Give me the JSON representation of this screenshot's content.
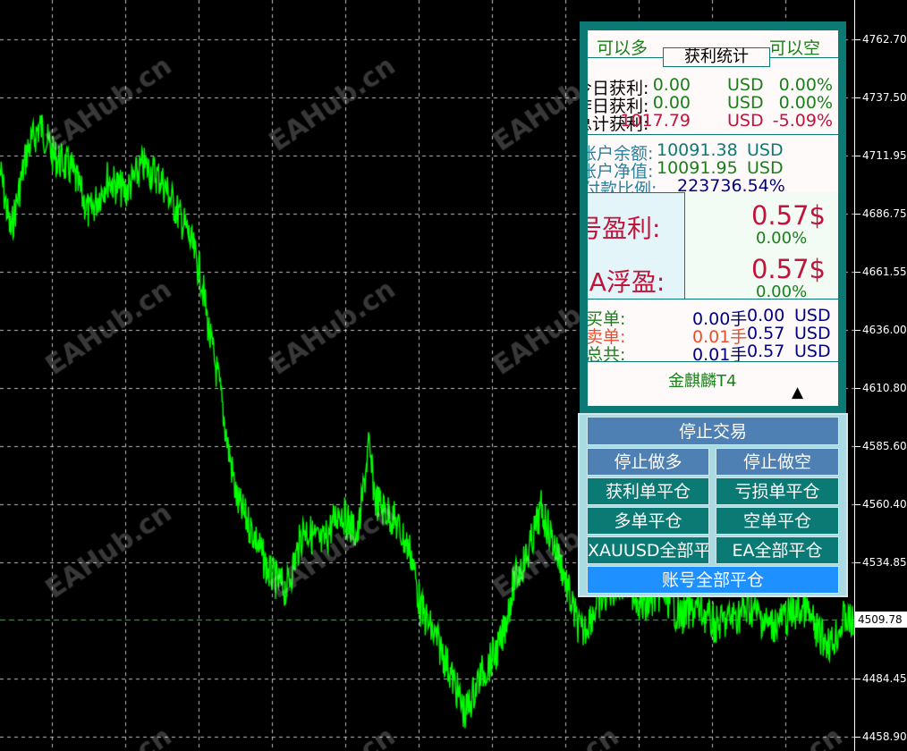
{
  "chart": {
    "series_color": "#00ff00",
    "grid_color": "#ffffff",
    "background": "#000000",
    "current_price": "4509.78",
    "price_axis": [
      "4762.70",
      "4737.50",
      "4711.95",
      "4686.75",
      "4661.55",
      "4636.00",
      "4610.80",
      "4585.60",
      "4560.40",
      "4534.85",
      "4509.78",
      "4484.45",
      "4458.90"
    ],
    "watermark": "EAHub.cn"
  },
  "stats": {
    "can_long": "可以多",
    "can_short": "可以空",
    "title": "获利统计",
    "rows": [
      {
        "label": "今日获利:",
        "value": "0.00",
        "unit": "USD",
        "pct": "0.00%",
        "color": "#1a7f1a"
      },
      {
        "label": "昨日获利:",
        "value": "0.00",
        "unit": "USD",
        "pct": "0.00%",
        "color": "#1a7f1a"
      },
      {
        "label": "总计获利:",
        "value": "1017.79",
        "unit": "USD",
        "pct": "-5.09%",
        "color": "#c0143c"
      }
    ],
    "balance_label": "账户余额:",
    "balance_value": "10091.38",
    "balance_unit": "USD",
    "equity_label": "账户净值:",
    "equity_value": "10091.95",
    "equity_unit": "USD",
    "margin_label": "预付款比例:",
    "margin_value": "223736.54%",
    "account_profit_label": "账号盈利:",
    "account_profit_value": "0.57$",
    "account_profit_pct": "0.00%",
    "ea_float_label": "EA浮盈:",
    "ea_float_value": "0.57$",
    "ea_float_pct": "0.00%",
    "orders": [
      {
        "label": "买单:",
        "lots": "0.00手",
        "amount": "0.00",
        "unit": "USD",
        "label_color": "#1a7f1a",
        "lots_color": "#000080"
      },
      {
        "label": "卖单:",
        "lots": "0.01手",
        "amount": "0.57",
        "unit": "USD",
        "label_color": "#e8502c",
        "lots_color": "#e8502c"
      },
      {
        "label": "总共:",
        "lots": "0.01手",
        "amount": "0.57",
        "unit": "USD",
        "label_color": "#1a7f1a",
        "lots_color": "#000080"
      }
    ],
    "ea_name": "金麒麟T4",
    "collapse_arrow": "▲"
  },
  "controls": {
    "stop_trading": "停止交易",
    "stop_long": "停止做多",
    "stop_short": "停止做空",
    "close_profit": "获利单平仓",
    "close_loss": "亏损单平仓",
    "close_long": "多单平仓",
    "close_short": "空单平仓",
    "close_symbol": "XAUUSD全部平仓",
    "close_ea": "EA全部平仓",
    "close_account": "账号全部平仓"
  }
}
